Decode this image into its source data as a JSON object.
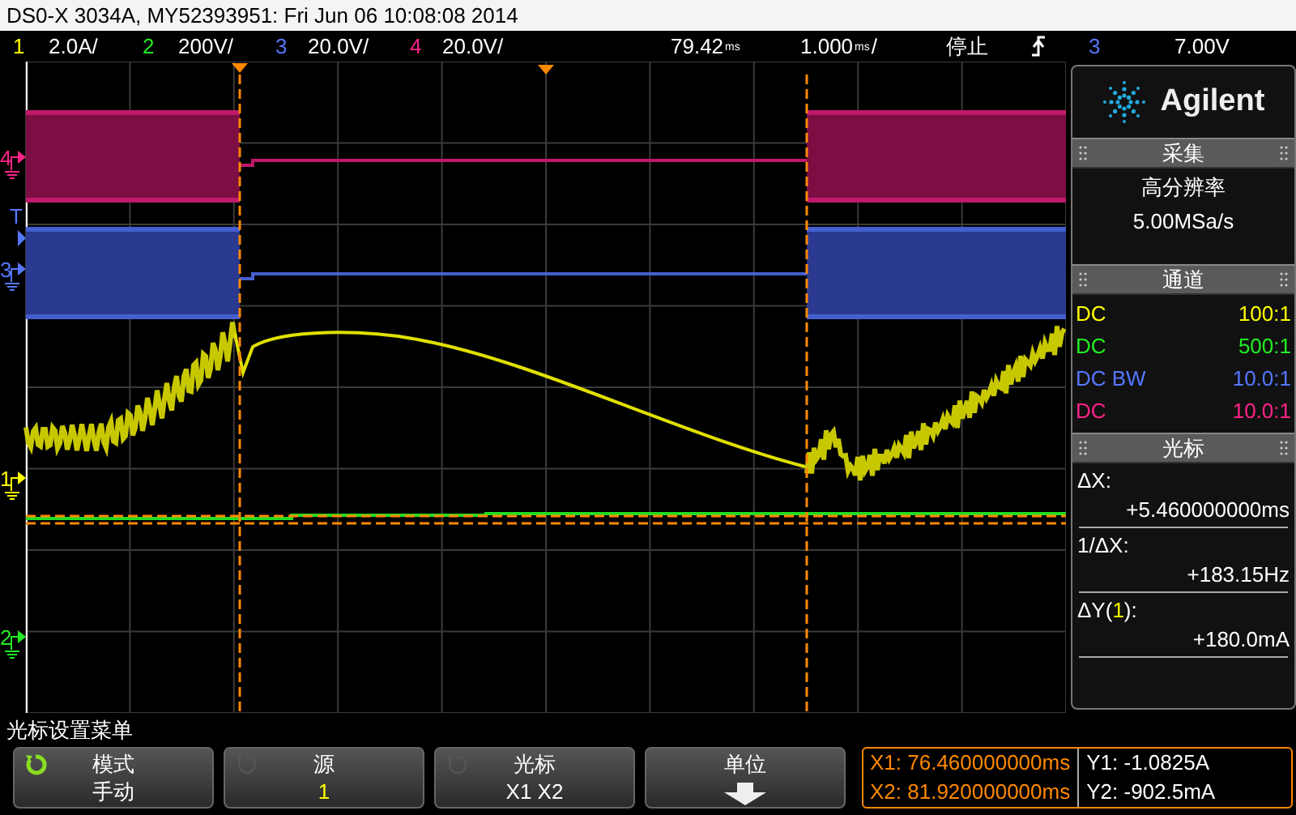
{
  "title_bar": {
    "text": "DS0-X 3034A, MY52393951: Fri Jun 06 10:08:08 2014"
  },
  "channel_bar": {
    "channels": [
      {
        "number": "1",
        "scale": "2.0A/",
        "color": "#ffff00"
      },
      {
        "number": "2",
        "scale": "200V/",
        "color": "#22ee22"
      },
      {
        "number": "3",
        "scale": "20.0V/",
        "color": "#5577ff"
      },
      {
        "number": "4",
        "scale": "20.0V/",
        "color": "#ff2288"
      }
    ],
    "delay": "79.42",
    "delay_unit": "ms",
    "timebase": "1.000",
    "timebase_unit": "ms",
    "timebase_suffix": "/",
    "run_state": "停止",
    "trigger": {
      "source": "3",
      "color": "#5577ff",
      "level": "7.00V"
    }
  },
  "scope": {
    "markers": [
      {
        "kind": "channel",
        "label": "4",
        "color": "#ff2288"
      },
      {
        "kind": "trigger",
        "label": "T",
        "color": "#5577ff"
      },
      {
        "kind": "channel",
        "label": "3",
        "color": "#5577ff"
      },
      {
        "kind": "channel",
        "label": "1",
        "color": "#ffff00"
      },
      {
        "kind": "channel",
        "label": "2",
        "color": "#22ee22"
      }
    ]
  },
  "panel": {
    "brand": "Agilent",
    "acquisition": {
      "header": "采集",
      "mode": "高分辨率",
      "rate": "5.00MSa/s"
    },
    "channels": {
      "header": "通道",
      "rows": [
        {
          "coupling": "DC",
          "probe": "100:1",
          "color": "#ffff00"
        },
        {
          "coupling": "DC",
          "probe": "500:1",
          "color": "#22ee22"
        },
        {
          "coupling": "DC BW",
          "probe": "10.0:1",
          "color": "#5577ff"
        },
        {
          "coupling": "DC",
          "probe": "10.0:1",
          "color": "#ff2288"
        }
      ]
    },
    "cursors": {
      "header": "光标",
      "readings": [
        {
          "label": "ΔX:",
          "value": "+5.460000000ms"
        },
        {
          "label": "1/ΔX:",
          "value": "+183.15Hz"
        },
        {
          "label": "ΔY(",
          "source": "1",
          "color": "#ffff00",
          "label_end": "):",
          "value": "+180.0mA"
        }
      ]
    }
  },
  "menu": {
    "title": "光标设置菜单",
    "softkeys": [
      {
        "kind": "toggle",
        "active": true,
        "title": "模式",
        "value": "手动"
      },
      {
        "kind": "toggle",
        "active": false,
        "title": "源",
        "value": "1",
        "color": "#ffff00"
      },
      {
        "kind": "toggle",
        "active": false,
        "title": "光标",
        "value": "X1 X2"
      },
      {
        "kind": "submenu",
        "title": "单位"
      }
    ]
  },
  "readout": {
    "x1": "X1: 76.460000000ms",
    "x2": "X2: 81.920000000ms",
    "y1": "Y1: -1.0825A",
    "y2": "Y2: -902.5mA"
  }
}
